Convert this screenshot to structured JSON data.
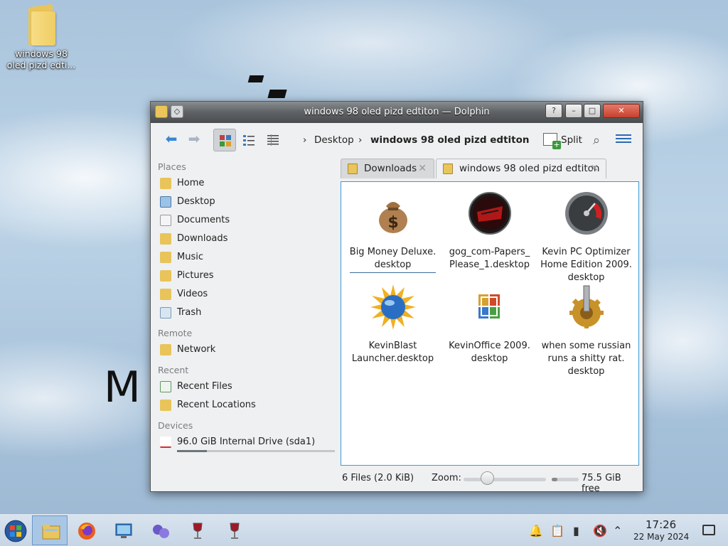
{
  "desktop": {
    "icon_label": "windows 98 oled pizd edti...",
    "background_text": "M"
  },
  "window": {
    "title": "windows 98 oled pizd edtiton — Dolphin",
    "help_glyph": "?",
    "minimize_glyph": "–",
    "maximize_glyph": "□",
    "close_glyph": "✕"
  },
  "toolbar": {
    "back_glyph": "⬅",
    "forward_glyph": "➡",
    "breadcrumb": [
      "Desktop",
      "windows 98 oled pizd edtiton"
    ],
    "crumb_separator": "›",
    "split_label": "Split"
  },
  "sidebar": {
    "sections": {
      "places": "Places",
      "remote": "Remote",
      "recent": "Recent",
      "devices": "Devices"
    },
    "places": [
      {
        "label": "Home",
        "icon": "home-folder-icon",
        "color": "#e8c45a"
      },
      {
        "label": "Desktop",
        "icon": "desktop-folder-icon",
        "color": "#9cc3e6"
      },
      {
        "label": "Documents",
        "icon": "documents-folder-icon",
        "color": "#e8c45a"
      },
      {
        "label": "Downloads",
        "icon": "downloads-folder-icon",
        "color": "#e8c45a"
      },
      {
        "label": "Music",
        "icon": "music-folder-icon",
        "color": "#e8c45a"
      },
      {
        "label": "Pictures",
        "icon": "pictures-folder-icon",
        "color": "#e8c45a"
      },
      {
        "label": "Videos",
        "icon": "videos-folder-icon",
        "color": "#e8c45a"
      },
      {
        "label": "Trash",
        "icon": "trash-icon",
        "color": "#b8d0e6"
      }
    ],
    "remote": [
      {
        "label": "Network",
        "icon": "network-folder-icon"
      }
    ],
    "recent": [
      {
        "label": "Recent Files",
        "icon": "recent-files-icon"
      },
      {
        "label": "Recent Locations",
        "icon": "recent-locations-icon"
      }
    ],
    "devices": [
      {
        "label": "96.0 GiB Internal Drive (sda1)",
        "icon": "drive-icon",
        "used_fraction": 0.19
      }
    ]
  },
  "tabs": [
    {
      "label": "Downloads",
      "close_glyph": "✕"
    },
    {
      "label": "windows 98 oled pizd edtiton",
      "close_glyph": "✕"
    }
  ],
  "files": [
    {
      "name": "Big Money Deluxe.\ndesktop",
      "icon": "money-bag-icon",
      "selected": true
    },
    {
      "name": "gog_com-Papers_\nPlease_1.desktop",
      "icon": "papers-please-icon",
      "selected": false
    },
    {
      "name": "Kevin PC Optimizer\nHome Edition 2009.\ndesktop",
      "icon": "speedometer-icon",
      "selected": false
    },
    {
      "name": "KevinBlast\nLauncher.desktop",
      "icon": "sun-globe-icon",
      "selected": false
    },
    {
      "name": "KevinOffice 2009.\ndesktop",
      "icon": "office-icon",
      "selected": false
    },
    {
      "name": "when some russian\nruns a shitty rat.\ndesktop",
      "icon": "gear-icon",
      "selected": false
    }
  ],
  "status": {
    "summary": "6 Files (2.0 KiB)",
    "zoom_label": "Zoom:",
    "free_space": "75.5 GiB free",
    "free_used_fraction": 0.2
  },
  "taskbar": {
    "time": "17:26",
    "date": "22 May 2024",
    "apps": [
      {
        "name": "start-menu-icon"
      },
      {
        "name": "dolphin-file-manager-icon",
        "active": true
      },
      {
        "name": "firefox-icon"
      },
      {
        "name": "system-settings-icon"
      },
      {
        "name": "connect-icon"
      },
      {
        "name": "wine-glass-icon"
      },
      {
        "name": "wine-glass-icon"
      }
    ]
  }
}
